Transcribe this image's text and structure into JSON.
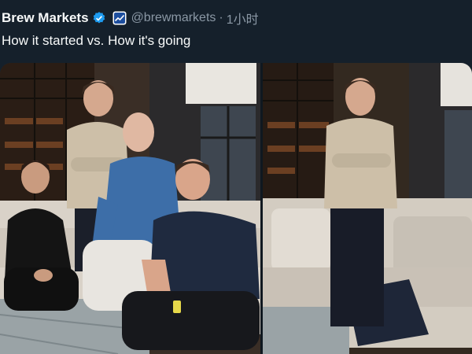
{
  "author": {
    "name": "Brew Markets",
    "handle": "@brewmarkets",
    "separator": "·",
    "time": "1小时"
  },
  "tweet": {
    "text": "How it started vs. How it's going"
  },
  "media": {
    "panels": [
      "photo-left-four-people",
      "photo-right-one-person"
    ]
  },
  "colors": {
    "background": "#15202b",
    "verified": "#1d9bf0",
    "muted": "#8b98a5"
  }
}
